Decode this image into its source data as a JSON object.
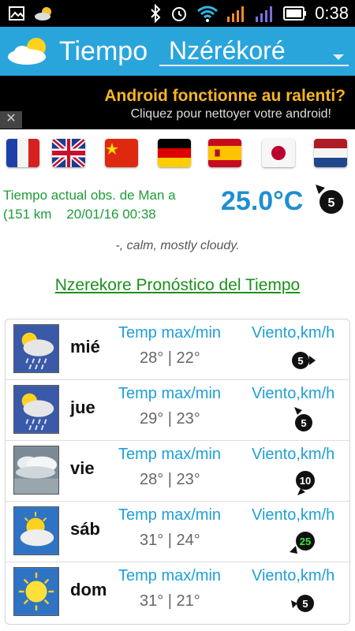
{
  "status_bar": {
    "time": "0:38"
  },
  "app_bar": {
    "title": "Tiempo",
    "city": "Nzérékoré"
  },
  "ad": {
    "line1": "Android fonctionne au ralenti?",
    "line2": "Cliquez pour nettoyer votre android!",
    "close_label": "✕"
  },
  "current": {
    "obs_line1": "Tiempo actual obs. de Man a",
    "obs_line2": "(151 km    20/01/16 00:38",
    "temperature": "25.0°C",
    "wind_speed": "5",
    "description": "-, calm, mostly cloudy."
  },
  "forecast_title": "Nzerekore Pronóstico del Tiempo",
  "forecast": [
    {
      "day": "mié",
      "temp_label": "Temp max/min",
      "temps": "28° | 22°",
      "wind_label": "Viento,km/h",
      "wind": "5",
      "icon": "cloud-sun-rain-icon"
    },
    {
      "day": "jue",
      "temp_label": "Temp max/min",
      "temps": "29° | 23°",
      "wind_label": "Viento,km/h",
      "wind": "5",
      "icon": "cloud-sun-rain-icon"
    },
    {
      "day": "vie",
      "temp_label": "Temp max/min",
      "temps": "28° | 23°",
      "wind_label": "Viento,km/h",
      "wind": "10",
      "icon": "overcast-icon"
    },
    {
      "day": "sáb",
      "temp_label": "Temp max/min",
      "temps": "31° | 24°",
      "wind_label": "Viento,km/h",
      "wind": "25",
      "icon": "partly-cloudy-icon"
    },
    {
      "day": "dom",
      "temp_label": "Temp max/min",
      "temps": "31° | 21°",
      "wind_label": "Viento,km/h",
      "wind": "5",
      "icon": "sunny-icon"
    }
  ],
  "colors": {
    "appbar": "#29a5dc",
    "accent_green": "#1e9c37",
    "temp_blue": "#1e8fd1",
    "ad_yellow": "#f7b521"
  }
}
